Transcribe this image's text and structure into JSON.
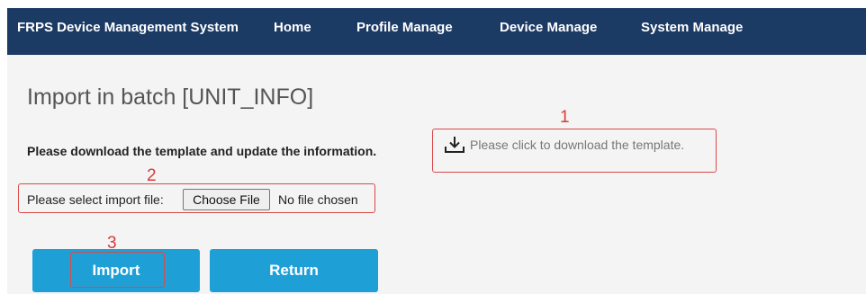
{
  "app": {
    "title": "FRPS Device Management System"
  },
  "nav": {
    "items": [
      {
        "label": "Home"
      },
      {
        "label": "Profile Manage"
      },
      {
        "label": "Device Manage"
      },
      {
        "label": "System Manage"
      }
    ]
  },
  "page": {
    "title": "Import in batch [UNIT_INFO]",
    "instruction": "Please download the template and update the information.",
    "download_link": "Please click to download the template.",
    "file_label": "Please select import file:",
    "choose_file": "Choose File",
    "file_status": "No file chosen"
  },
  "buttons": {
    "import": "Import",
    "return": "Return"
  },
  "annotations": {
    "step1": "1",
    "step2": "2",
    "step3": "3"
  },
  "colors": {
    "navbar": "#1b3a64",
    "button": "#1ea0d7",
    "annotation": "#d94a4a",
    "content_bg": "#f4f4f4"
  }
}
